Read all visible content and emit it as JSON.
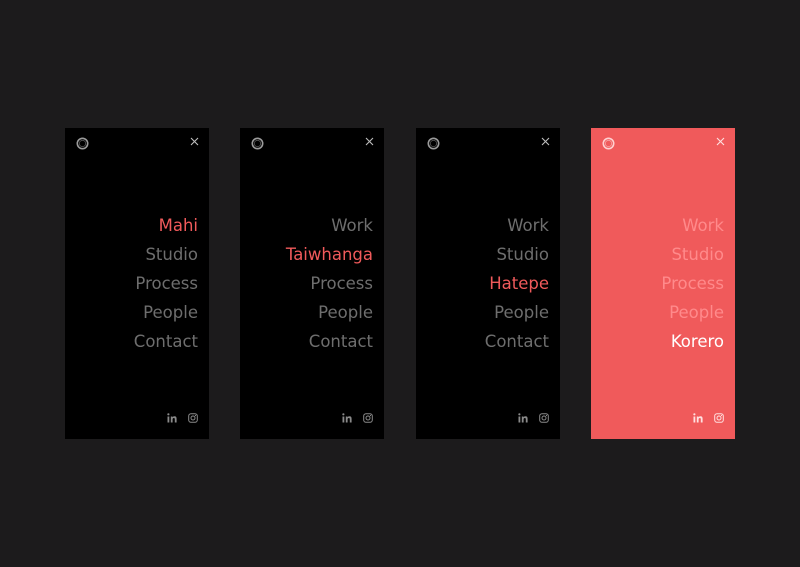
{
  "colors": {
    "background": "#1c1b1c",
    "panel": "#000000",
    "accent": "#f05a5b",
    "menu_inactive": "#6e6e6e",
    "menu_inactive_on_accent": "#ff8a8b",
    "menu_active_on_accent": "#ffffff"
  },
  "panels": [
    {
      "menu": [
        "Mahi",
        "Studio",
        "Process",
        "People",
        "Contact"
      ],
      "active": 0
    },
    {
      "menu": [
        "Work",
        "Taiwhanga",
        "Process",
        "People",
        "Contact"
      ],
      "active": 1
    },
    {
      "menu": [
        "Work",
        "Studio",
        "Hatepe",
        "People",
        "Contact"
      ],
      "active": 2
    },
    {
      "menu": [
        "Work",
        "Studio",
        "Process",
        "People",
        "Korero"
      ],
      "active": 4
    }
  ],
  "icons": {
    "logo": "ring-logo-icon",
    "close": "close-icon",
    "social": [
      "linkedin-icon",
      "instagram-icon"
    ]
  }
}
